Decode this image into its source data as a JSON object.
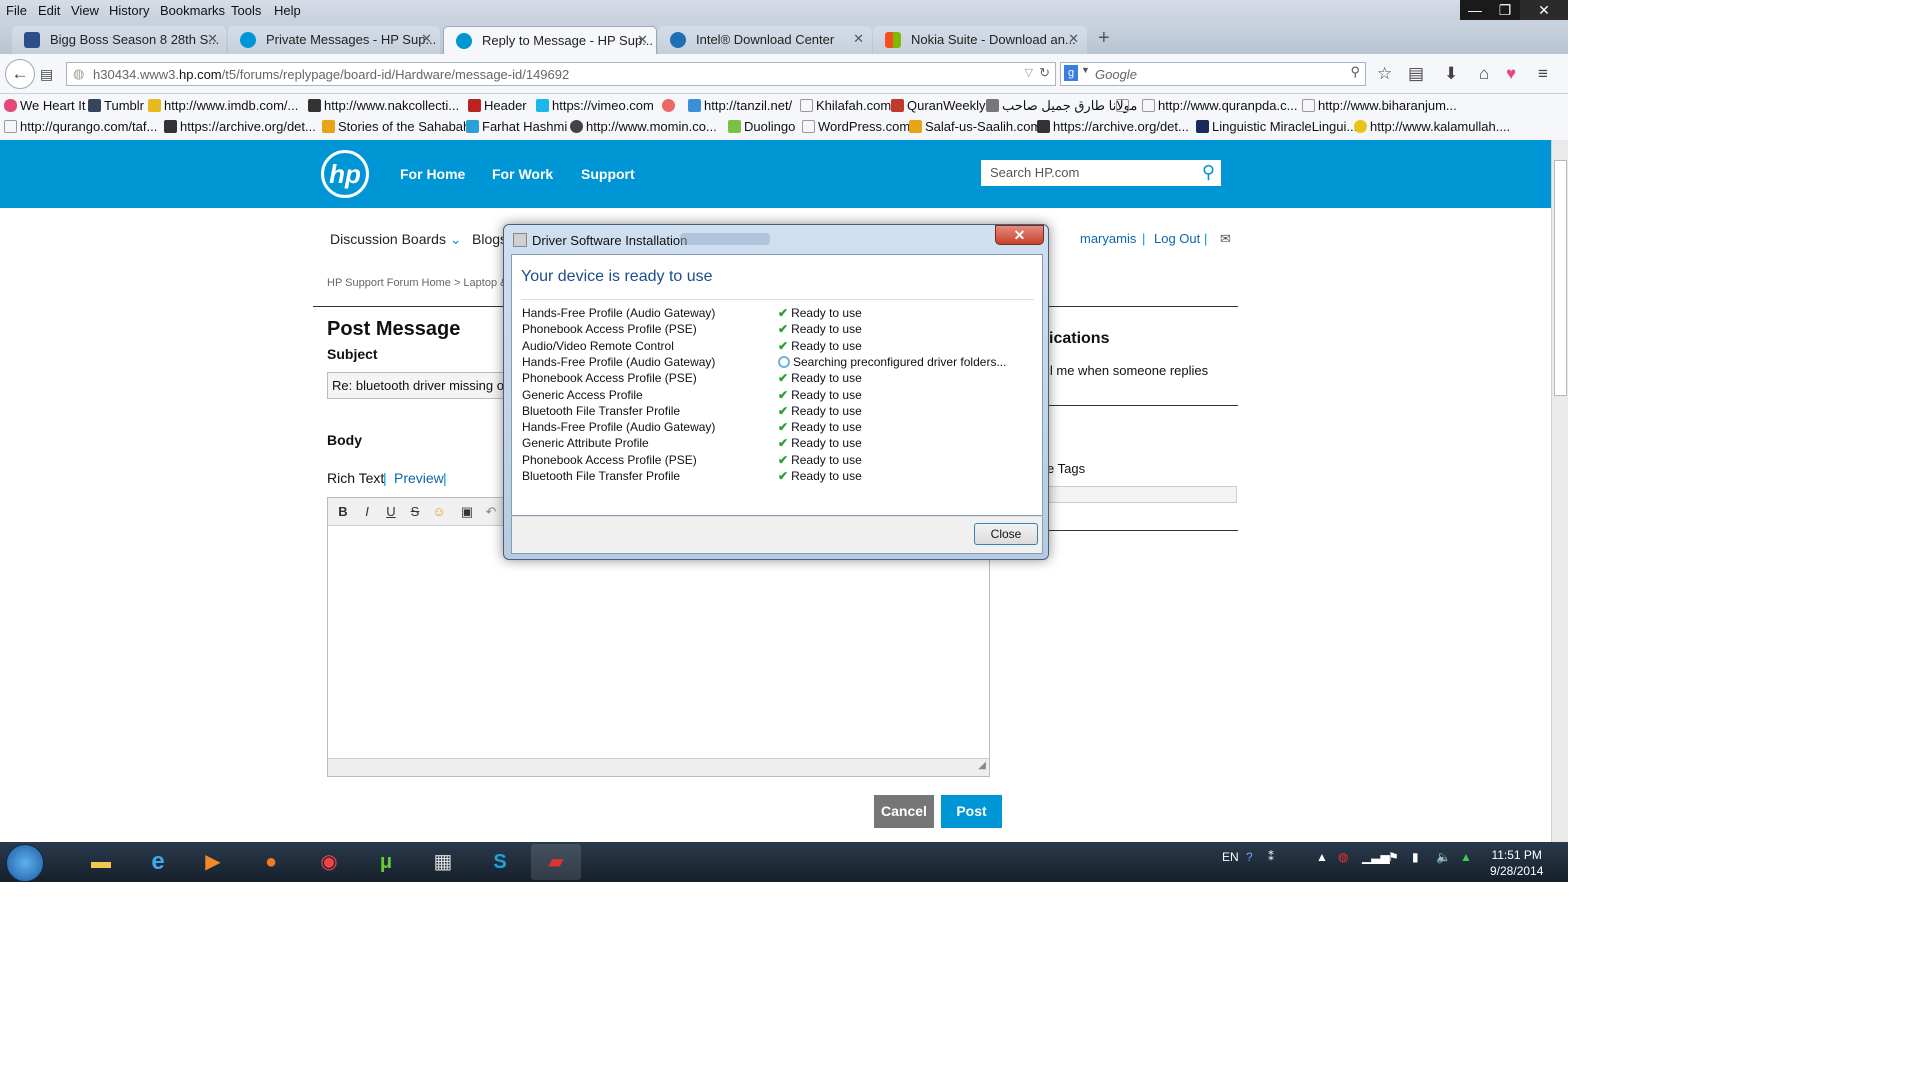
{
  "menubar": [
    "File",
    "Edit",
    "View",
    "History",
    "Bookmarks",
    "Tools",
    "Help"
  ],
  "window_controls": {
    "minimize": "—",
    "restore": "❐",
    "close": "✕"
  },
  "tabs": [
    {
      "label": "Bigg Boss Season 8 28th S...",
      "active": false
    },
    {
      "label": "Private Messages - HP Sup...",
      "active": false
    },
    {
      "label": "Reply to Message - HP Sup...",
      "active": true
    },
    {
      "label": "Intel® Download Center",
      "active": false
    },
    {
      "label": "Nokia Suite - Download an...",
      "active": false
    }
  ],
  "address": {
    "prefix": "h30434.www3.",
    "domain": "hp.com",
    "path": "/t5/forums/replypage/board-id/Hardware/message-id/149692"
  },
  "search_placeholder": "Google",
  "bookmarks_row1": [
    "We Heart It",
    "Tumblr",
    "http://www.imdb.com/...",
    "http://www.nakcollecti...",
    "Header",
    "https://vimeo.com",
    "http://tanzil.net/",
    "Khilafah.com",
    "QuranWeekly",
    "مولانا طارق جمیل صاحب",
    "",
    "http://www.quranpda.c...",
    "http://www.biharanjum..."
  ],
  "bookmarks_row2": [
    "http://qurango.com/taf...",
    "https://archive.org/det...",
    "Stories of the Sahabah",
    "Farhat Hashmi",
    "http://www.momin.co...",
    "Duolingo",
    "WordPress.com",
    "Salaf-us-Saalih.com",
    "https://archive.org/det...",
    "Linguistic MiracleLingui...",
    "http://www.kalamullah...."
  ],
  "hp": {
    "logo": "hp",
    "nav": [
      "For Home",
      "For Work",
      "Support"
    ],
    "search_placeholder": "Search HP.com"
  },
  "subnav": {
    "discussion": "Discussion Boards",
    "blogs": "Blogs",
    "user": "maryamis",
    "logout": "Log Out"
  },
  "breadcrumb": "HP Support Forum Home  >  Laptop & N",
  "post": {
    "title": "Post Message",
    "subject_label": "Subject",
    "subject_value": "Re: bluetooth driver missing on H",
    "body_label": "Body",
    "rich_text": "Rich Text",
    "preview": "Preview",
    "cancel": "Cancel",
    "post": "Post"
  },
  "right_panel": {
    "notifications": "ications",
    "email_me": "il me when someone replies",
    "tags": "e Tags"
  },
  "dialog": {
    "title": "Driver Software Installation",
    "heading": "Your device is ready to use",
    "close_button": "Close",
    "drivers": [
      {
        "name": "Hands-Free Profile (Audio Gateway)",
        "status": "Ready to use",
        "state": "ready"
      },
      {
        "name": "Phonebook Access Profile (PSE)",
        "status": "Ready to use",
        "state": "ready"
      },
      {
        "name": "Audio/Video Remote Control",
        "status": "Ready to use",
        "state": "ready"
      },
      {
        "name": "Hands-Free Profile (Audio Gateway)",
        "status": "Searching preconfigured driver folders...",
        "state": "searching"
      },
      {
        "name": "Phonebook Access Profile (PSE)",
        "status": "Ready to use",
        "state": "ready"
      },
      {
        "name": "Generic Access Profile",
        "status": "Ready to use",
        "state": "ready"
      },
      {
        "name": "Bluetooth File Transfer Profile",
        "status": "Ready to use",
        "state": "ready"
      },
      {
        "name": "Hands-Free Profile (Audio Gateway)",
        "status": "Ready to use",
        "state": "ready"
      },
      {
        "name": "Generic Attribute Profile",
        "status": "Ready to use",
        "state": "ready"
      },
      {
        "name": "Phonebook Access Profile (PSE)",
        "status": "Ready to use",
        "state": "ready"
      },
      {
        "name": "Bluetooth File Transfer Profile",
        "status": "Ready to use",
        "state": "ready"
      }
    ]
  },
  "taskbar": {
    "lang": "EN",
    "time": "11:51 PM",
    "date": "9/28/2014"
  },
  "colors": {
    "hp_blue": "#0096d6",
    "dialog_heading": "#1e4d8c",
    "check": "#2e9b2e"
  }
}
